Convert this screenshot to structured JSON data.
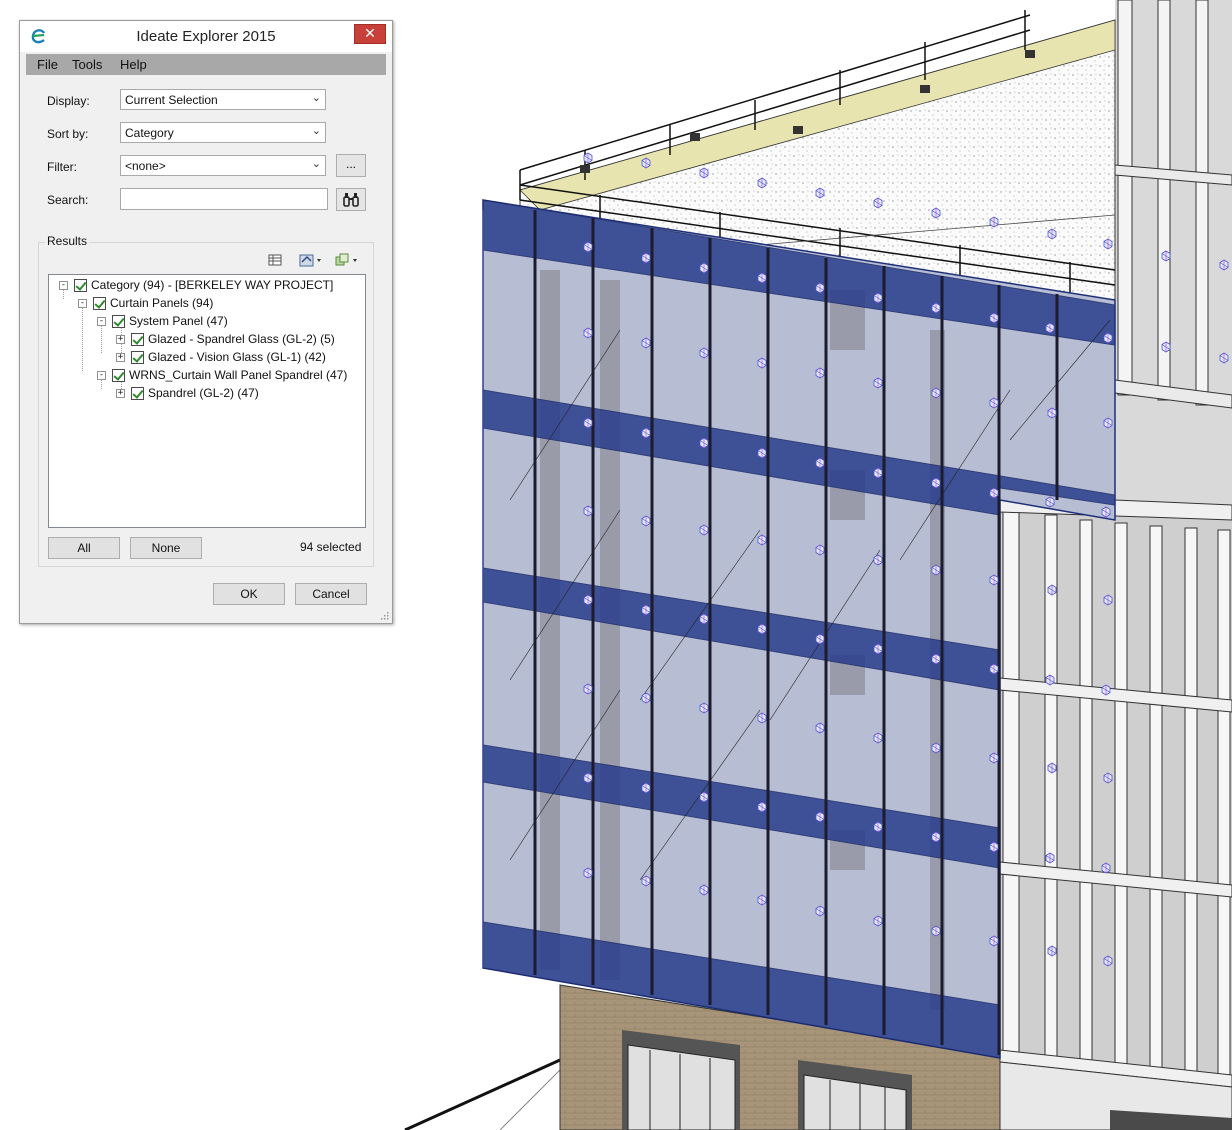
{
  "dialog": {
    "title": "Ideate Explorer 2015",
    "close_glyph": "✕",
    "menu": [
      "File",
      "Tools",
      "Help"
    ],
    "display": {
      "label": "Display:",
      "value": "Current Selection"
    },
    "sort_by": {
      "label": "Sort by:",
      "value": "Category"
    },
    "filter": {
      "label": "Filter:",
      "value": "<none>",
      "button_label": "..."
    },
    "search": {
      "label": "Search:",
      "value": "",
      "button_icon": "binoculars-icon"
    },
    "results": {
      "label": "Results",
      "toolbar_icons": [
        "grid-view-icon",
        "select-dropdown-icon",
        "isolate-dropdown-icon"
      ],
      "tree": [
        {
          "label": "Category (94) - [BERKELEY WAY PROJECT]",
          "level": 0,
          "expander": "-",
          "checked": true
        },
        {
          "label": "Curtain Panels (94)",
          "level": 1,
          "expander": "-",
          "checked": true
        },
        {
          "label": "System Panel (47)",
          "level": 2,
          "expander": "-",
          "checked": true
        },
        {
          "label": "Glazed - Spandrel Glass (GL-2) (5)",
          "level": 3,
          "expander": "+",
          "checked": true
        },
        {
          "label": "Glazed - Vision Glass (GL-1) (42)",
          "level": 3,
          "expander": "+",
          "checked": true
        },
        {
          "label": "WRNS_Curtain Wall Panel Spandrel (47)",
          "level": 2,
          "expander": "-",
          "checked": true
        },
        {
          "label": "Spandrel (GL-2) (47)",
          "level": 3,
          "expander": "+",
          "checked": true
        }
      ]
    },
    "all_button": "All",
    "none_button": "None",
    "selected_count": "94 selected",
    "ok_button": "OK",
    "cancel_button": "Cancel"
  },
  "colors": {
    "curtain_wall_selected": "#2a3d8c",
    "close_button": "#c8403a",
    "menubar": "#a8a8a8",
    "roof_parapet": "#e8e4b0"
  }
}
